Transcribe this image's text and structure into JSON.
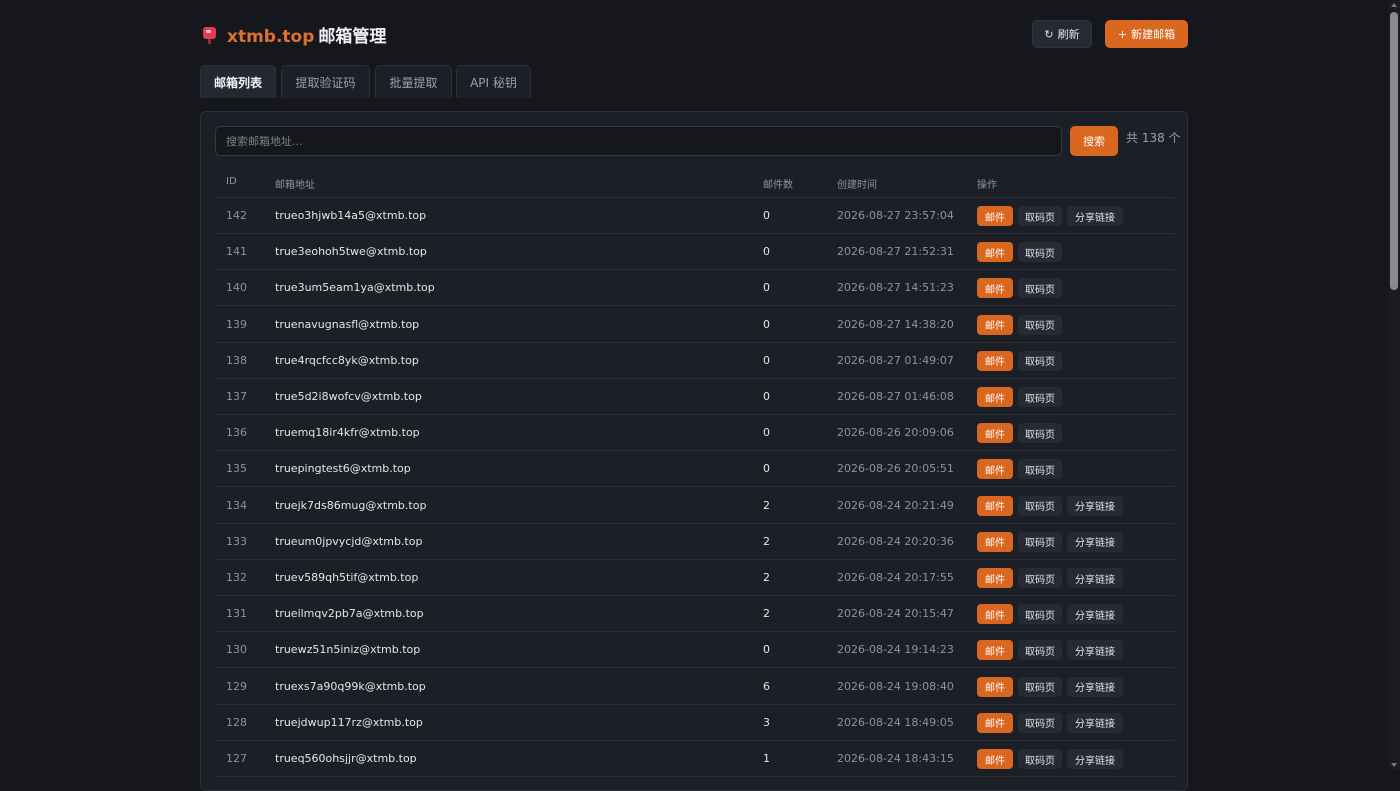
{
  "app": {
    "domain": "xtmb.top",
    "title_rest": "邮箱管理"
  },
  "header": {
    "refresh_label": "刷新",
    "new_label": "新建邮箱"
  },
  "tabs": [
    {
      "label": "邮箱列表",
      "active": true
    },
    {
      "label": "提取验证码",
      "active": false
    },
    {
      "label": "批量提取",
      "active": false
    },
    {
      "label": "API 秘钥",
      "active": false
    }
  ],
  "search": {
    "placeholder": "搜索邮箱地址...",
    "value": "",
    "button_label": "搜索",
    "total_label": "共 138 个"
  },
  "table": {
    "headers": {
      "id": "ID",
      "email": "邮箱地址",
      "count": "邮件数",
      "created": "创建时间",
      "actions": "操作"
    },
    "actions": {
      "mail": "邮件",
      "code": "取码页",
      "share": "分享链接"
    },
    "rows": [
      {
        "id": "142",
        "email": "trueo3hjwb14a5@xtmb.top",
        "count": "0",
        "created": "2026-08-27 23:57:04",
        "share": true
      },
      {
        "id": "141",
        "email": "true3eohoh5twe@xtmb.top",
        "count": "0",
        "created": "2026-08-27 21:52:31",
        "share": false
      },
      {
        "id": "140",
        "email": "true3um5eam1ya@xtmb.top",
        "count": "0",
        "created": "2026-08-27 14:51:23",
        "share": false
      },
      {
        "id": "139",
        "email": "truenavugnasfl@xtmb.top",
        "count": "0",
        "created": "2026-08-27 14:38:20",
        "share": false
      },
      {
        "id": "138",
        "email": "true4rqcfcc8yk@xtmb.top",
        "count": "0",
        "created": "2026-08-27 01:49:07",
        "share": false
      },
      {
        "id": "137",
        "email": "true5d2i8wofcv@xtmb.top",
        "count": "0",
        "created": "2026-08-27 01:46:08",
        "share": false
      },
      {
        "id": "136",
        "email": "truemq18ir4kfr@xtmb.top",
        "count": "0",
        "created": "2026-08-26 20:09:06",
        "share": false
      },
      {
        "id": "135",
        "email": "truepingtest6@xtmb.top",
        "count": "0",
        "created": "2026-08-26 20:05:51",
        "share": false
      },
      {
        "id": "134",
        "email": "truejk7ds86mug@xtmb.top",
        "count": "2",
        "created": "2026-08-24 20:21:49",
        "share": true
      },
      {
        "id": "133",
        "email": "trueum0jpvycjd@xtmb.top",
        "count": "2",
        "created": "2026-08-24 20:20:36",
        "share": true
      },
      {
        "id": "132",
        "email": "truev589qh5tif@xtmb.top",
        "count": "2",
        "created": "2026-08-24 20:17:55",
        "share": true
      },
      {
        "id": "131",
        "email": "trueilmqv2pb7a@xtmb.top",
        "count": "2",
        "created": "2026-08-24 20:15:47",
        "share": true
      },
      {
        "id": "130",
        "email": "truewz51n5iniz@xtmb.top",
        "count": "0",
        "created": "2026-08-24 19:14:23",
        "share": true
      },
      {
        "id": "129",
        "email": "truexs7a90q99k@xtmb.top",
        "count": "6",
        "created": "2026-08-24 19:08:40",
        "share": true
      },
      {
        "id": "128",
        "email": "truejdwup117rz@xtmb.top",
        "count": "3",
        "created": "2026-08-24 18:49:05",
        "share": true
      },
      {
        "id": "127",
        "email": "trueq560ohsjjr@xtmb.top",
        "count": "1",
        "created": "2026-08-24 18:43:15",
        "share": true
      }
    ]
  },
  "colors": {
    "accent": "#d9671f",
    "background": "#15171d",
    "panel": "#1c1f26"
  },
  "icons": {
    "logo": "mailbox-icon",
    "refresh": "refresh-icon",
    "add": "plus-icon"
  }
}
